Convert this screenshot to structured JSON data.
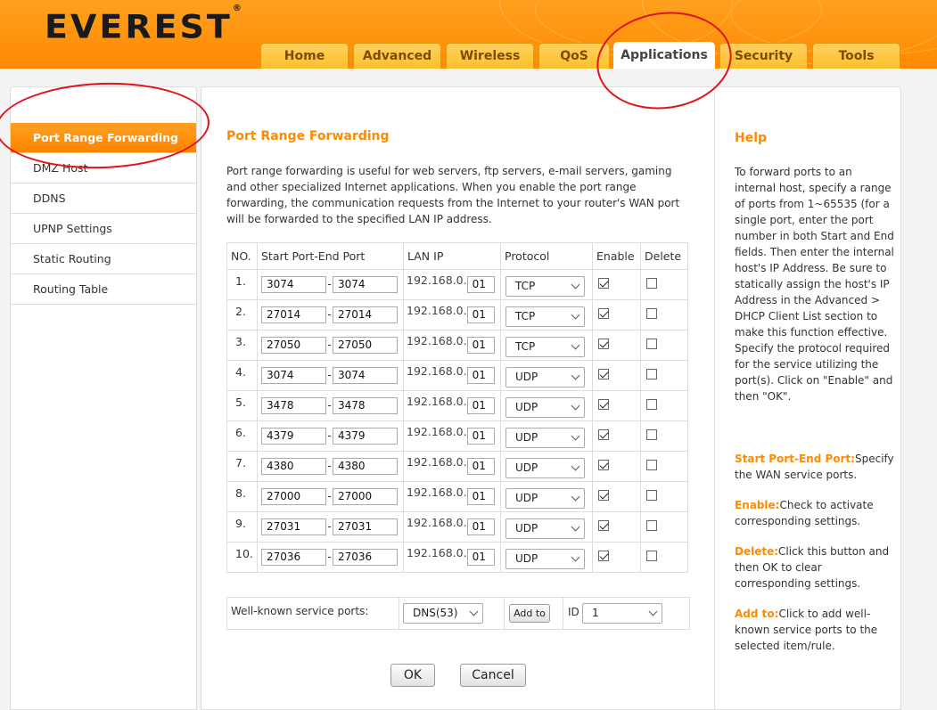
{
  "brand": {
    "name": "EVEREST",
    "mark": "®"
  },
  "tabs": [
    {
      "label": "Home",
      "active": false
    },
    {
      "label": "Advanced",
      "active": false
    },
    {
      "label": "Wireless",
      "active": false
    },
    {
      "label": "QoS",
      "active": false
    },
    {
      "label": "Applications",
      "active": true
    },
    {
      "label": "Security",
      "active": false
    },
    {
      "label": "Tools",
      "active": false
    }
  ],
  "sidebar": {
    "items": [
      {
        "label": "Port Range Forwarding",
        "active": true
      },
      {
        "label": "DMZ Host",
        "active": false
      },
      {
        "label": "DDNS",
        "active": false
      },
      {
        "label": "UPNP Settings",
        "active": false
      },
      {
        "label": "Static Routing",
        "active": false
      },
      {
        "label": "Routing Table",
        "active": false
      }
    ]
  },
  "main": {
    "title": "Port Range Forwarding",
    "description": "Port range forwarding is useful for web servers, ftp servers, e-mail servers, gaming and other specialized Internet applications. When you enable the port range forwarding, the communication requests from the Internet to your router's WAN port will be forwarded to the specified LAN IP address.",
    "table": {
      "headers": {
        "no": "NO.",
        "ports": "Start Port-End Port",
        "lan_ip": "LAN IP",
        "protocol": "Protocol",
        "enable": "Enable",
        "delete": "Delete"
      },
      "ip_prefix": "192.168.0.",
      "port_separator": "-",
      "rows": [
        {
          "no": "1.",
          "start": "3074",
          "end": "3074",
          "ip_end": "01",
          "protocol": "TCP",
          "enabled": true,
          "delete": false
        },
        {
          "no": "2.",
          "start": "27014",
          "end": "27014",
          "ip_end": "01",
          "protocol": "TCP",
          "enabled": true,
          "delete": false
        },
        {
          "no": "3.",
          "start": "27050",
          "end": "27050",
          "ip_end": "01",
          "protocol": "TCP",
          "enabled": true,
          "delete": false
        },
        {
          "no": "4.",
          "start": "3074",
          "end": "3074",
          "ip_end": "01",
          "protocol": "UDP",
          "enabled": true,
          "delete": false
        },
        {
          "no": "5.",
          "start": "3478",
          "end": "3478",
          "ip_end": "01",
          "protocol": "UDP",
          "enabled": true,
          "delete": false
        },
        {
          "no": "6.",
          "start": "4379",
          "end": "4379",
          "ip_end": "01",
          "protocol": "UDP",
          "enabled": true,
          "delete": false
        },
        {
          "no": "7.",
          "start": "4380",
          "end": "4380",
          "ip_end": "01",
          "protocol": "UDP",
          "enabled": true,
          "delete": false
        },
        {
          "no": "8.",
          "start": "27000",
          "end": "27000",
          "ip_end": "01",
          "protocol": "UDP",
          "enabled": true,
          "delete": false
        },
        {
          "no": "9.",
          "start": "27031",
          "end": "27031",
          "ip_end": "01",
          "protocol": "UDP",
          "enabled": true,
          "delete": false
        },
        {
          "no": "10.",
          "start": "27036",
          "end": "27036",
          "ip_end": "01",
          "protocol": "UDP",
          "enabled": true,
          "delete": false
        }
      ]
    },
    "well_known": {
      "label": "Well-known service ports:",
      "service_value": "DNS(53)",
      "add_button": "Add to",
      "id_label": "ID",
      "id_value": "1"
    },
    "ok_button": "OK",
    "cancel_button": "Cancel"
  },
  "help": {
    "title": "Help",
    "intro": "To forward ports to an internal host, specify a range of ports from 1~65535 (for a single port, enter the port number in both Start and End fields. Then enter the internal host's IP Address. Be sure to statically assign the host's IP Address in the Advanced > DHCP Client List section to make this function effective. Specify the protocol required for the service utilizing the port(s). Click on \"Enable\" and then \"OK\".",
    "items": [
      {
        "term": "Start Port-End Port:",
        "text": "Specify the WAN service ports."
      },
      {
        "term": "Enable:",
        "text": "Check to activate corresponding settings."
      },
      {
        "term": "Delete:",
        "text": "Click this button and then OK to clear corresponding settings."
      },
      {
        "term": "Add to:",
        "text": "Click to add well-known service ports to the selected item/rule."
      }
    ]
  },
  "colors": {
    "accent": "#ff8a00",
    "annotation": "#e0141c"
  }
}
